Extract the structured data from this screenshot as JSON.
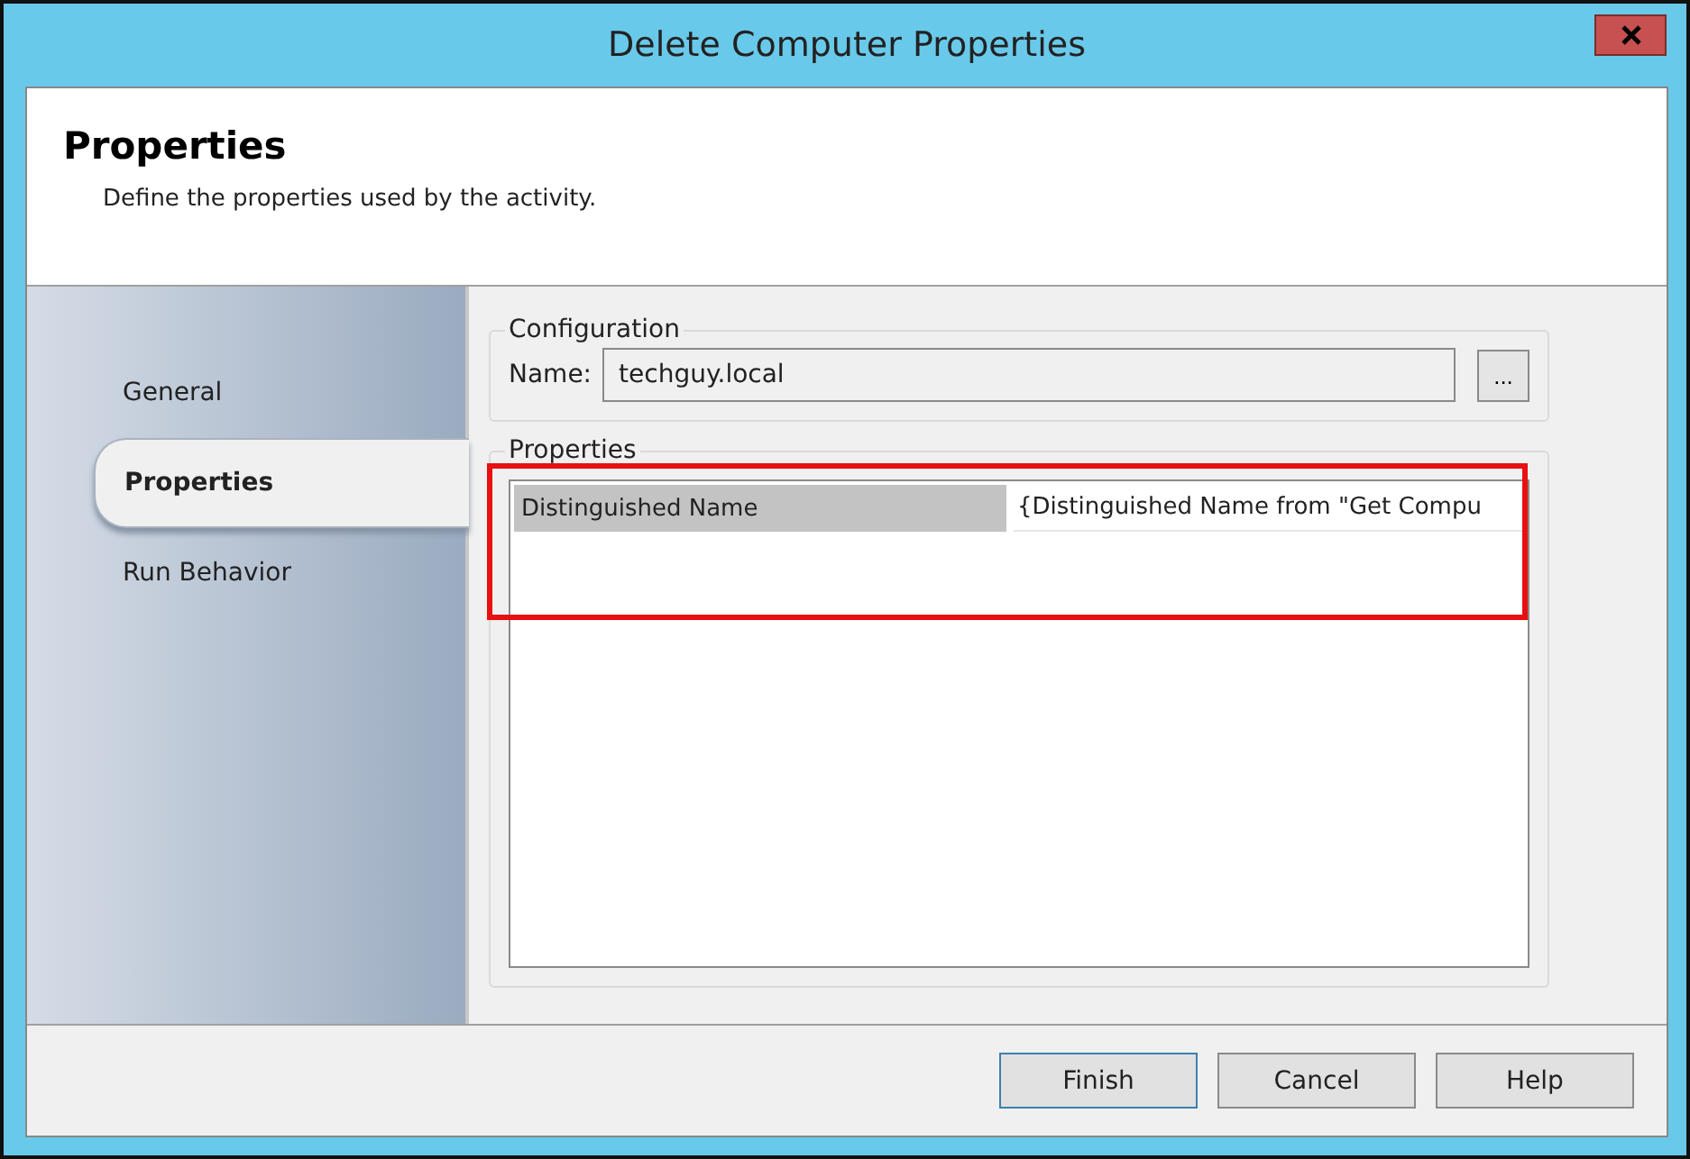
{
  "window": {
    "title": "Delete Computer Properties"
  },
  "header": {
    "title": "Properties",
    "subtitle": "Define the properties used by the activity."
  },
  "tabs": [
    {
      "label": "General",
      "selected": false
    },
    {
      "label": "Properties",
      "selected": true
    },
    {
      "label": "Run Behavior",
      "selected": false
    }
  ],
  "configuration": {
    "legend": "Configuration",
    "name_label": "Name:",
    "name_value": "techguy.local",
    "browse_button": "..."
  },
  "properties": {
    "legend": "Properties",
    "highlighted": true,
    "rows": [
      {
        "name": "Distinguished Name",
        "value": "{Distinguished Name from \"Get Compu",
        "selected": true
      }
    ]
  },
  "buttons": [
    {
      "label": "Finish",
      "default": true
    },
    {
      "label": "Cancel",
      "default": false
    },
    {
      "label": "Help",
      "default": false
    }
  ]
}
